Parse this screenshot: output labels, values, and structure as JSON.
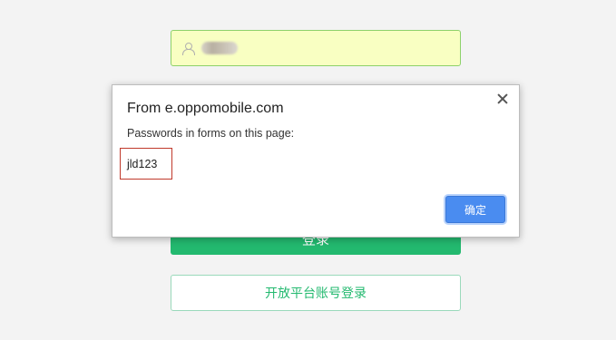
{
  "login_page": {
    "login_button": "登录",
    "platform_login_button": "开放平台账号登录"
  },
  "dialog": {
    "title": "From e.oppomobile.com",
    "message": "Passwords in forms on this page:",
    "password": "jld123",
    "ok_button": "确定"
  }
}
